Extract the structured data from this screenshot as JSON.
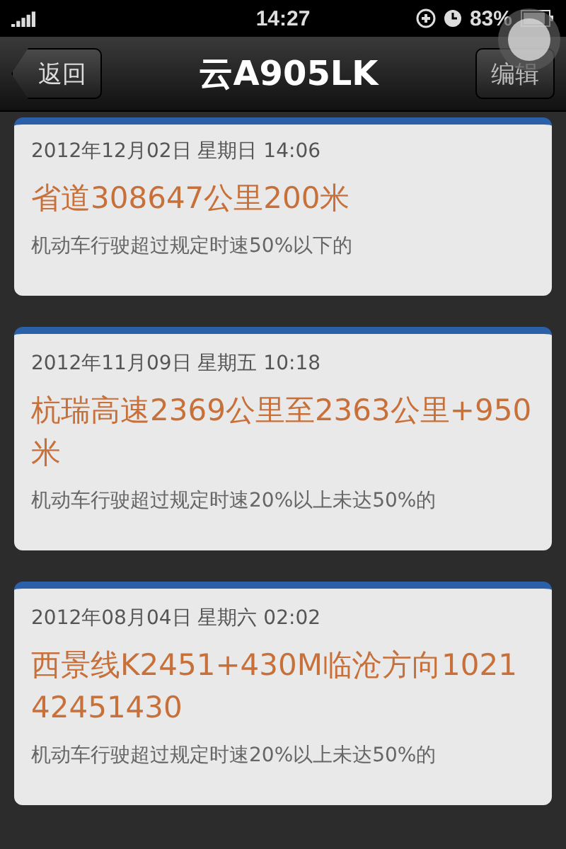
{
  "status_bar": {
    "time": "14:27",
    "battery": "83%"
  },
  "nav": {
    "back": "返回",
    "title": "云A905LK",
    "edit": "编辑"
  },
  "records": [
    {
      "date": "2012年12月02日 星期日 14:06",
      "location": "省道308647公里200米",
      "violation": "机动车行驶超过规定时速50%以下的"
    },
    {
      "date": "2012年11月09日 星期五 10:18",
      "location": "杭瑞高速2369公里至2363公里+950米",
      "violation": "机动车行驶超过规定时速20%以上未达50%的"
    },
    {
      "date": "2012年08月04日 星期六 02:02",
      "location": "西景线K2451+430M临沧方向102142451430",
      "violation": "机动车行驶超过规定时速20%以上未达50%的"
    }
  ]
}
